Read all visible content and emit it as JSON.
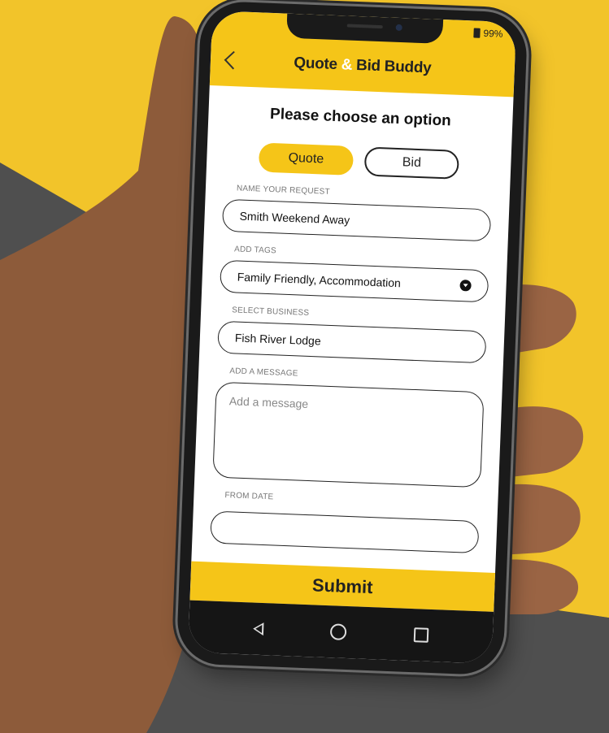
{
  "status_bar": {
    "battery": "99%"
  },
  "app": {
    "title_part1": "Quote ",
    "title_amp": "&",
    "title_part2": " Bid Buddy"
  },
  "form": {
    "question": "Please choose an option",
    "options": [
      {
        "label": "Quote",
        "selected": true
      },
      {
        "label": "Bid",
        "selected": false
      }
    ],
    "request_name": {
      "label": "NAME YOUR REQUEST",
      "value": "Smith Weekend Away"
    },
    "tags": {
      "label": "ADD TAGS",
      "value": "Family Friendly, Accommodation"
    },
    "business": {
      "label": "SELECT BUSINESS",
      "value": "Fish River Lodge"
    },
    "message": {
      "label": "ADD A MESSAGE",
      "placeholder": "Add a message"
    },
    "from_date": {
      "label": "FROM DATE"
    }
  },
  "submit_label": "Submit",
  "icons": {
    "back": "chevron-left-icon",
    "dropdown": "dropdown-circle-icon",
    "nav_back": "triangle-back-icon",
    "nav_home": "circle-home-icon",
    "nav_recent": "square-recent-icon"
  },
  "colors": {
    "background_yellow": "#f2c42a",
    "background_gray": "#4f4f4f",
    "accent_yellow": "#f5c518",
    "text_dark": "#222222"
  }
}
